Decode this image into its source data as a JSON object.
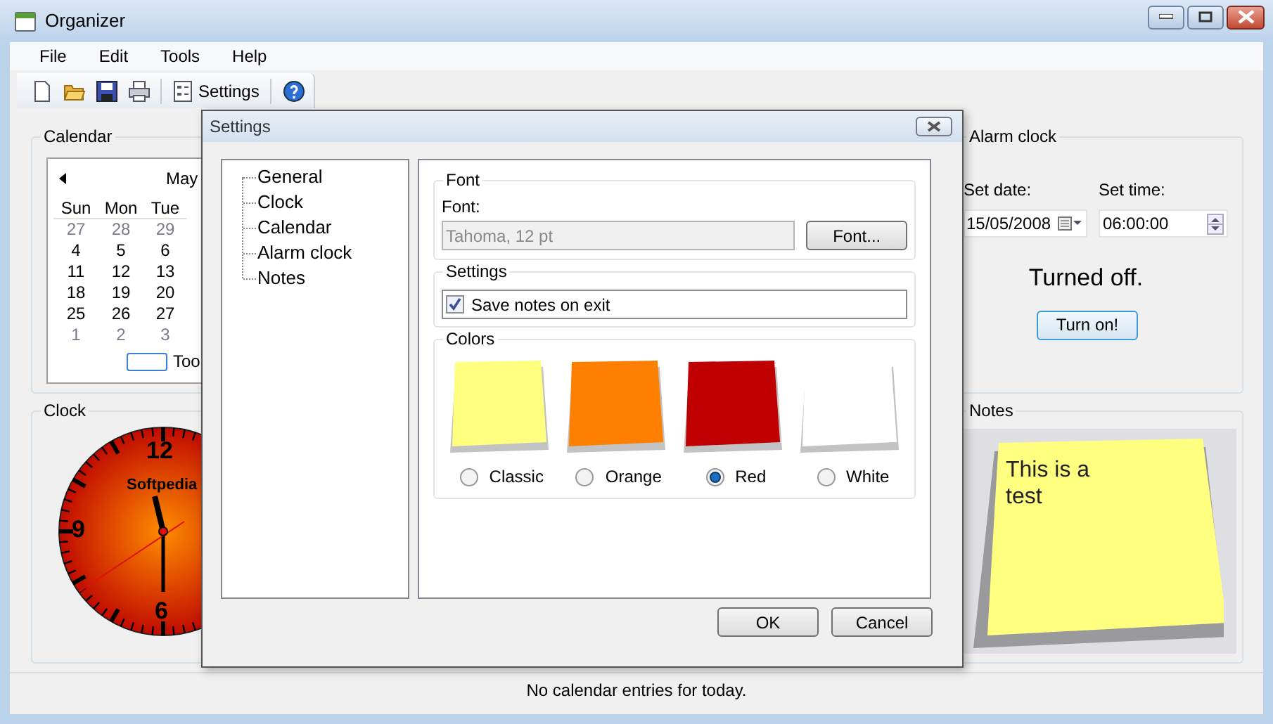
{
  "window": {
    "title": "Organizer"
  },
  "menu": [
    "File",
    "Edit",
    "Tools",
    "Help"
  ],
  "toolbar": [
    {
      "kind": "new"
    },
    {
      "kind": "open"
    },
    {
      "kind": "save"
    },
    {
      "kind": "print"
    },
    {
      "kind": "settings",
      "label": "Settings"
    },
    {
      "kind": "help"
    }
  ],
  "calendar": {
    "title": "Calendar",
    "month": "May",
    "weekdays": [
      "Sun",
      "Mon",
      "Tue"
    ],
    "weeks": [
      [
        {
          "day": "27",
          "muted": true
        },
        {
          "day": "28",
          "muted": true
        },
        {
          "day": "29",
          "muted": true
        }
      ],
      [
        {
          "day": "4",
          "muted": false
        },
        {
          "day": "5",
          "muted": false
        },
        {
          "day": "6",
          "muted": false
        }
      ],
      [
        {
          "day": "11",
          "muted": false
        },
        {
          "day": "12",
          "muted": false
        },
        {
          "day": "13",
          "muted": false
        }
      ],
      [
        {
          "day": "18",
          "muted": false
        },
        {
          "day": "19",
          "muted": false
        },
        {
          "day": "20",
          "muted": false
        }
      ],
      [
        {
          "day": "25",
          "muted": false
        },
        {
          "day": "26",
          "muted": false
        },
        {
          "day": "27",
          "muted": false
        }
      ],
      [
        {
          "day": "1",
          "muted": true
        },
        {
          "day": "2",
          "muted": true
        },
        {
          "day": "3",
          "muted": true
        }
      ]
    ],
    "today_label": "Too"
  },
  "clock": {
    "title": "Clock",
    "numerals": [
      "12",
      "9",
      "6"
    ],
    "brand": "Softpedia"
  },
  "alarm": {
    "title": "Alarm clock",
    "date_label": "Set date:",
    "date": "15/05/2008",
    "time_label": "Set time:",
    "time": "06:00:00",
    "status": "Turned off.",
    "button": "Turn on!"
  },
  "notes": {
    "title": "Notes",
    "text": "This is a test"
  },
  "status_bar": "No calendar entries for today.",
  "dialog": {
    "title": "Settings",
    "tree": [
      "General",
      "Clock",
      "Calendar",
      "Alarm clock",
      "Notes"
    ],
    "font_group": {
      "title": "Font",
      "label": "Font:",
      "value": "Tahoma, 12 pt",
      "disabled": true,
      "button": "Font..."
    },
    "settings_group": {
      "title": "Settings",
      "checkbox": {
        "label": "Save notes on exit",
        "checked": true
      }
    },
    "colors_group": {
      "title": "Colors",
      "options": [
        {
          "label": "Classic",
          "color": "#ffff80",
          "selected": false
        },
        {
          "label": "Orange",
          "color": "#ff8000",
          "selected": false
        },
        {
          "label": "Red",
          "color": "#c00000",
          "selected": true
        },
        {
          "label": "White",
          "color": "#ffffff",
          "selected": false
        }
      ]
    },
    "buttons": [
      "OK",
      "Cancel"
    ]
  }
}
